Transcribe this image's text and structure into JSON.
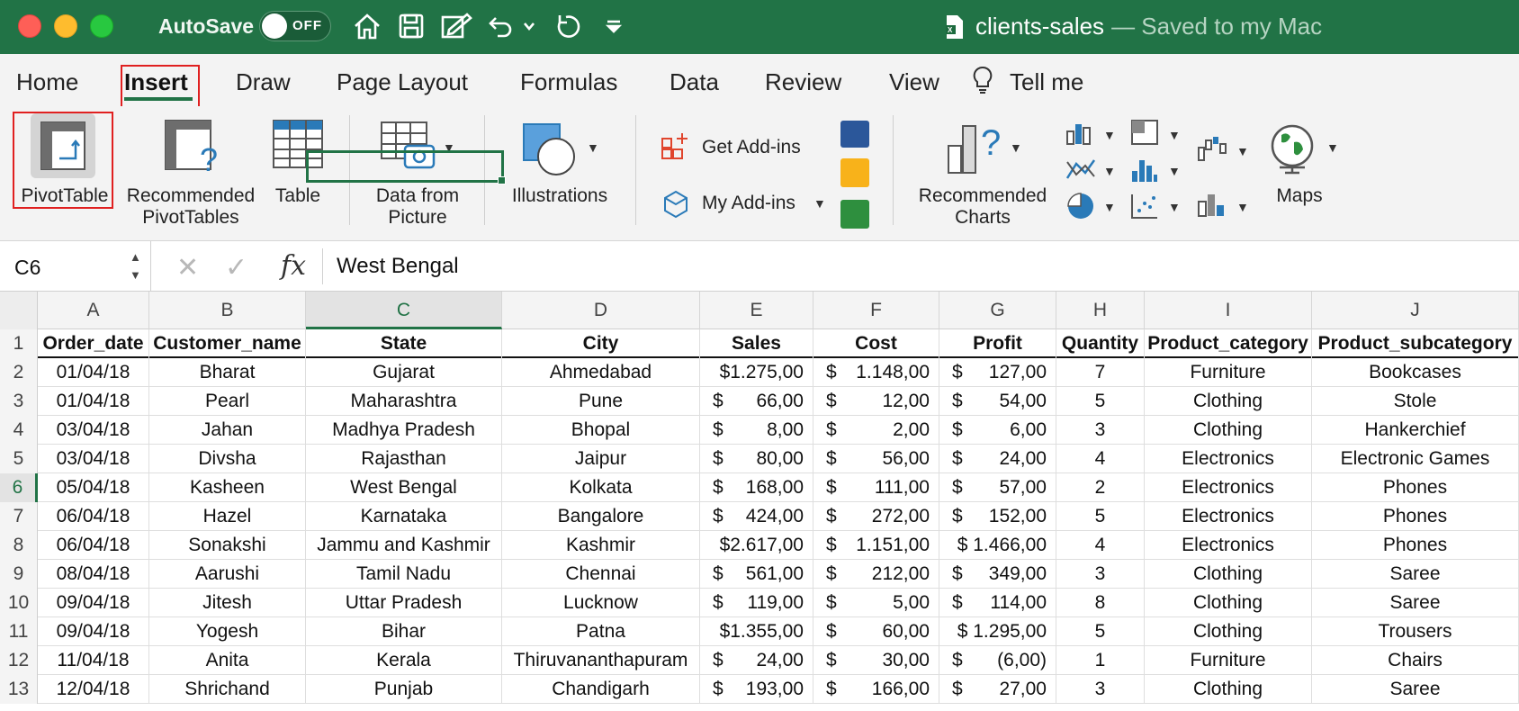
{
  "titlebar": {
    "autosave_label": "AutoSave",
    "autosave_state": "OFF",
    "doc_name": "clients-sales",
    "saved_status": "— Saved to my Mac",
    "accent": "#217346"
  },
  "tabs": [
    "Home",
    "Insert",
    "Draw",
    "Page Layout",
    "Formulas",
    "Data",
    "Review",
    "View",
    "Tell me"
  ],
  "active_tab": "Insert",
  "ribbon": {
    "pivot_table": "PivotTable",
    "recommended_pivot_1": "Recommended",
    "recommended_pivot_2": "PivotTables",
    "table": "Table",
    "data_from_picture_1": "Data from",
    "data_from_picture_2": "Picture",
    "illustrations": "Illustrations",
    "get_addins": "Get Add-ins",
    "my_addins": "My Add-ins",
    "recommended_charts_1": "Recommended",
    "recommended_charts_2": "Charts",
    "maps": "Maps"
  },
  "formula_bar": {
    "name_box": "C6",
    "fx": "fx",
    "value": "West Bengal"
  },
  "sheet": {
    "columns": [
      "A",
      "B",
      "C",
      "D",
      "E",
      "F",
      "G",
      "H",
      "I",
      "J"
    ],
    "row_numbers": [
      "1",
      "2",
      "3",
      "4",
      "5",
      "6",
      "7",
      "8",
      "9",
      "10",
      "11",
      "12",
      "13"
    ],
    "headers": [
      "Order_date",
      "Customer_name",
      "State",
      "City",
      "Sales",
      "Cost",
      "Profit",
      "Quantity",
      "Product_category",
      "Product_subcategory"
    ],
    "rows": [
      [
        "01/04/18",
        "Bharat",
        "Gujarat",
        "Ahmedabad",
        "$1.275,00",
        "1.148,00",
        "127,00",
        "7",
        "Furniture",
        "Bookcases"
      ],
      [
        "01/04/18",
        "Pearl",
        "Maharashtra",
        "Pune",
        "66,00",
        "12,00",
        "54,00",
        "5",
        "Clothing",
        "Stole"
      ],
      [
        "03/04/18",
        "Jahan",
        "Madhya Pradesh",
        "Bhopal",
        "8,00",
        "2,00",
        "6,00",
        "3",
        "Clothing",
        "Hankerchief"
      ],
      [
        "03/04/18",
        "Divsha",
        "Rajasthan",
        "Jaipur",
        "80,00",
        "56,00",
        "24,00",
        "4",
        "Electronics",
        "Electronic Games"
      ],
      [
        "05/04/18",
        "Kasheen",
        "West Bengal",
        "Kolkata",
        "168,00",
        "111,00",
        "57,00",
        "2",
        "Electronics",
        "Phones"
      ],
      [
        "06/04/18",
        "Hazel",
        "Karnataka",
        "Bangalore",
        "424,00",
        "272,00",
        "152,00",
        "5",
        "Electronics",
        "Phones"
      ],
      [
        "06/04/18",
        "Sonakshi",
        "Jammu and Kashmir",
        "Kashmir",
        "$2.617,00",
        "1.151,00",
        "$ 1.466,00",
        "4",
        "Electronics",
        "Phones"
      ],
      [
        "08/04/18",
        "Aarushi",
        "Tamil Nadu",
        "Chennai",
        "561,00",
        "212,00",
        "349,00",
        "3",
        "Clothing",
        "Saree"
      ],
      [
        "09/04/18",
        "Jitesh",
        "Uttar Pradesh",
        "Lucknow",
        "119,00",
        "5,00",
        "114,00",
        "8",
        "Clothing",
        "Saree"
      ],
      [
        "09/04/18",
        "Yogesh",
        "Bihar",
        "Patna",
        "$1.355,00",
        "60,00",
        "$ 1.295,00",
        "5",
        "Clothing",
        "Trousers"
      ],
      [
        "11/04/18",
        "Anita",
        "Kerala",
        "Thiruvananthapuram",
        "24,00",
        "30,00",
        "(6,00)",
        "1",
        "Furniture",
        "Chairs"
      ],
      [
        "12/04/18",
        "Shrichand",
        "Punjab",
        "Chandigarh",
        "193,00",
        "166,00",
        "27,00",
        "3",
        "Clothing",
        "Saree"
      ]
    ],
    "selected_cell": "C6",
    "selected_column": "C",
    "selected_row": "6"
  }
}
